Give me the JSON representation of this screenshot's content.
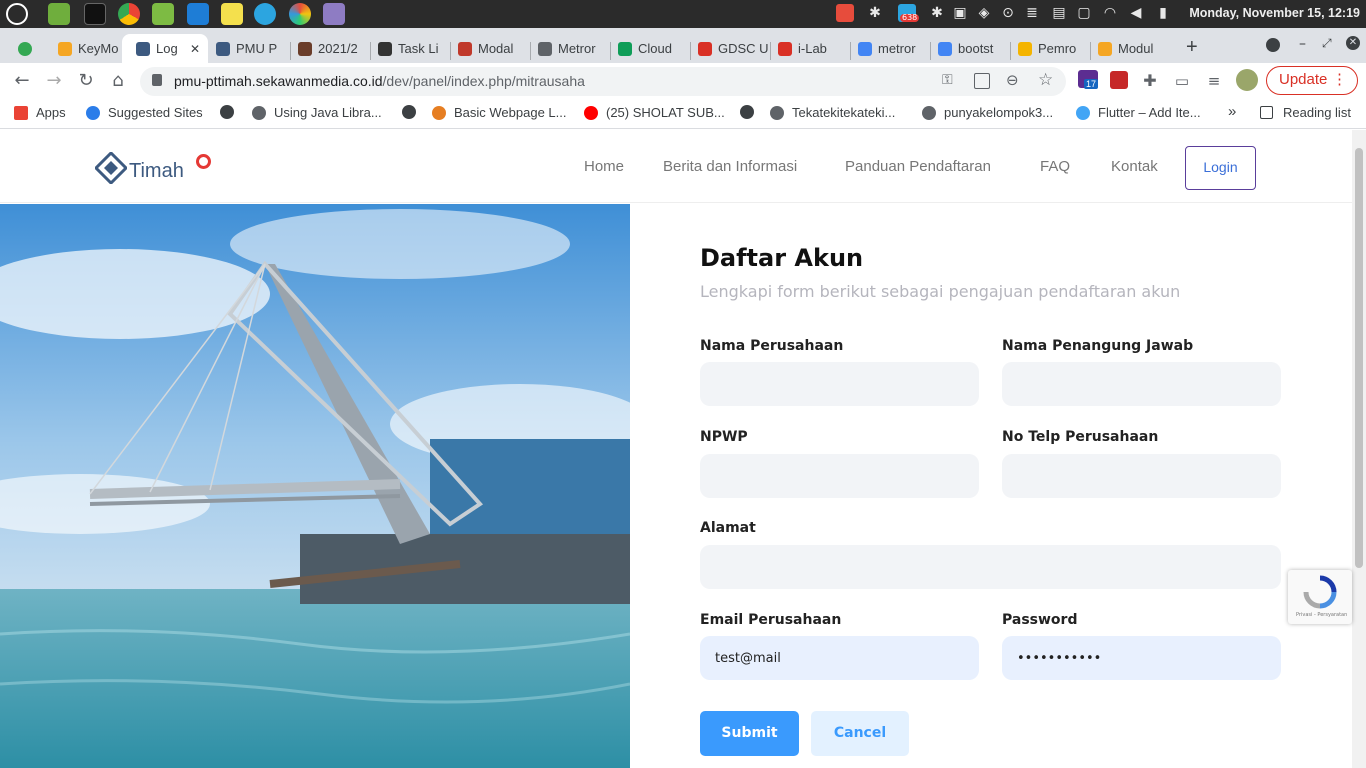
{
  "os": {
    "clock": "Monday, November 15, 12:19",
    "apps": [
      "mint-menu-icon",
      "files-icon",
      "terminal-icon",
      "chrome-icon",
      "folder-icon",
      "vscode-icon",
      "sticky-notes-icon",
      "telegram-icon",
      "color-app-icon",
      "text-editor-icon"
    ],
    "tray_badge_count": "638"
  },
  "browser": {
    "tabs": [
      {
        "label": "KeyMo",
        "icon": "coursera-icon",
        "color": "#f5a623"
      },
      {
        "label": "Log",
        "icon": "timah-icon",
        "color": "#3d5a80",
        "active": true
      },
      {
        "label": "PMU P",
        "icon": "timah-icon",
        "color": "#3d5a80"
      },
      {
        "label": "2021/2",
        "icon": "university-icon",
        "color": "#6a3d2a"
      },
      {
        "label": "Task Li",
        "icon": "check-icon",
        "color": "#333333"
      },
      {
        "label": "Modal",
        "icon": "m-logo-icon",
        "color": "#c0392b"
      },
      {
        "label": "Metror",
        "icon": "globe-icon",
        "color": "#5f6368"
      },
      {
        "label": "Cloud",
        "icon": "sheets-icon",
        "color": "#0f9d58"
      },
      {
        "label": "GDSC U",
        "icon": "gmail-icon",
        "color": "#d93025"
      },
      {
        "label": "i-Lab",
        "icon": "bookmark-icon",
        "color": "#d93025"
      },
      {
        "label": "metror",
        "icon": "google-icon",
        "color": "#4285f4"
      },
      {
        "label": "bootst",
        "icon": "google-icon",
        "color": "#4285f4"
      },
      {
        "label": "Pemro",
        "icon": "drive-icon",
        "color": "#f4b400"
      },
      {
        "label": "Modul",
        "icon": "coursera-icon",
        "color": "#f5a623"
      }
    ],
    "new_tab_label": "+",
    "url_host": "pmu-pttimah.sekawanmedia.co.id",
    "url_path": "/dev/panel/index.php/mitrausaha",
    "update_label": "Update",
    "extension_badge": "17",
    "bookmarks": [
      {
        "label": "Apps",
        "icon": "apps-grid-icon",
        "color": "#ea4335"
      },
      {
        "label": "Suggested Sites",
        "icon": "bing-icon",
        "color": "#2b7de9"
      },
      {
        "label": "",
        "icon": "globe-icon",
        "color": "#3c4043"
      },
      {
        "label": "Using Java Libra...",
        "icon": "globe-icon",
        "color": "#5f6368"
      },
      {
        "label": "",
        "icon": "globe-icon",
        "color": "#3c4043"
      },
      {
        "label": "Basic Webpage L...",
        "icon": "sololearn-icon",
        "color": "#e67e22"
      },
      {
        "label": "(25) SHOLAT SUB...",
        "icon": "youtube-icon",
        "color": "#ff0000"
      },
      {
        "label": "",
        "icon": "globe-icon",
        "color": "#3c4043"
      },
      {
        "label": "Tekatekitekateki...",
        "icon": "cr-icon",
        "color": "#5f6368"
      },
      {
        "label": "punyakelompok3...",
        "icon": "cr-icon",
        "color": "#5f6368"
      },
      {
        "label": "Flutter – Add Ite...",
        "icon": "flutter-icon",
        "color": "#42a5f5"
      }
    ],
    "bookmarks_more": "»",
    "reading_list_label": "Reading list"
  },
  "site": {
    "logo_text": "Timah",
    "nav": [
      "Home",
      "Berita dan Informasi",
      "Panduan Pendaftaran",
      "FAQ",
      "Kontak"
    ],
    "login_label": "Login"
  },
  "form": {
    "title": "Daftar Akun",
    "subtitle": "Lengkapi form berikut sebagai pengajuan pendaftaran akun",
    "fields": {
      "nama_perusahaan": {
        "label": "Nama Perusahaan",
        "value": ""
      },
      "nama_penanggung_jawab": {
        "label": "Nama Penangung Jawab",
        "value": ""
      },
      "npwp": {
        "label": "NPWP",
        "value": ""
      },
      "no_telp": {
        "label": "No Telp Perusahaan",
        "value": ""
      },
      "alamat": {
        "label": "Alamat",
        "value": ""
      },
      "email": {
        "label": "Email Perusahaan",
        "value": "test@mail"
      },
      "password": {
        "label": "Password",
        "value": "•••••••••••"
      }
    },
    "submit_label": "Submit",
    "cancel_label": "Cancel"
  },
  "recaptcha": {
    "footer": "Privasi - Persyaratan"
  }
}
